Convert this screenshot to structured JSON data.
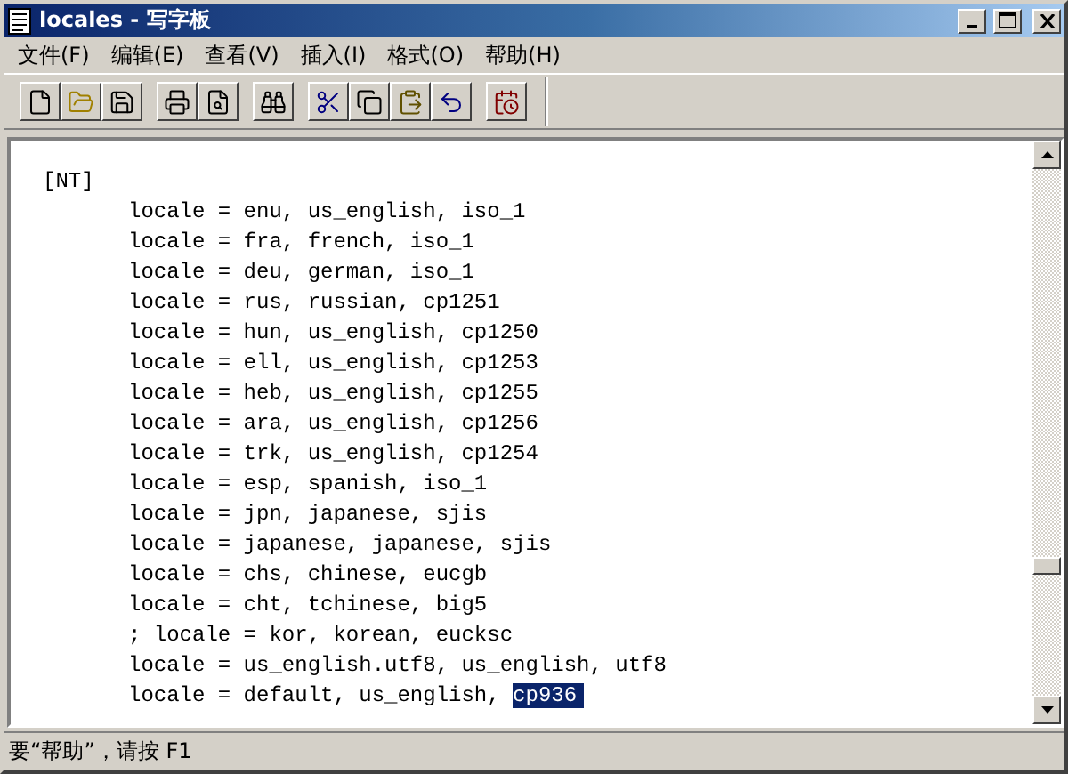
{
  "window": {
    "title": "locales - 写字板"
  },
  "menu": [
    "文件(F)",
    "编辑(E)",
    "查看(V)",
    "插入(I)",
    "格式(O)",
    "帮助(H)"
  ],
  "document": {
    "lines": [
      {
        "text": "[NT]",
        "indented": false
      },
      {
        "text": "locale = enu, us_english, iso_1",
        "indented": true
      },
      {
        "text": "locale = fra, french, iso_1",
        "indented": true
      },
      {
        "text": "locale = deu, german, iso_1",
        "indented": true
      },
      {
        "text": "locale = rus, russian, cp1251",
        "indented": true
      },
      {
        "text": "locale = hun, us_english, cp1250",
        "indented": true
      },
      {
        "text": "locale = ell, us_english, cp1253",
        "indented": true
      },
      {
        "text": "locale = heb, us_english, cp1255",
        "indented": true
      },
      {
        "text": "locale = ara, us_english, cp1256",
        "indented": true
      },
      {
        "text": "locale = trk, us_english, cp1254",
        "indented": true
      },
      {
        "text": "locale = esp, spanish, iso_1",
        "indented": true
      },
      {
        "text": "locale = jpn, japanese, sjis",
        "indented": true
      },
      {
        "text": "locale = japanese, japanese, sjis",
        "indented": true
      },
      {
        "text": "locale = chs, chinese, eucgb",
        "indented": true
      },
      {
        "text": "locale = cht, tchinese, big5",
        "indented": true
      },
      {
        "text": "; locale = kor, korean, eucksc",
        "indented": true
      },
      {
        "text": "locale = us_english.utf8, us_english, utf8",
        "indented": true
      },
      {
        "text": "locale = default, us_english, ",
        "selection": "cp936",
        "indented": true
      }
    ]
  },
  "status_bar": {
    "text": "要“帮助”，请按 F1"
  }
}
